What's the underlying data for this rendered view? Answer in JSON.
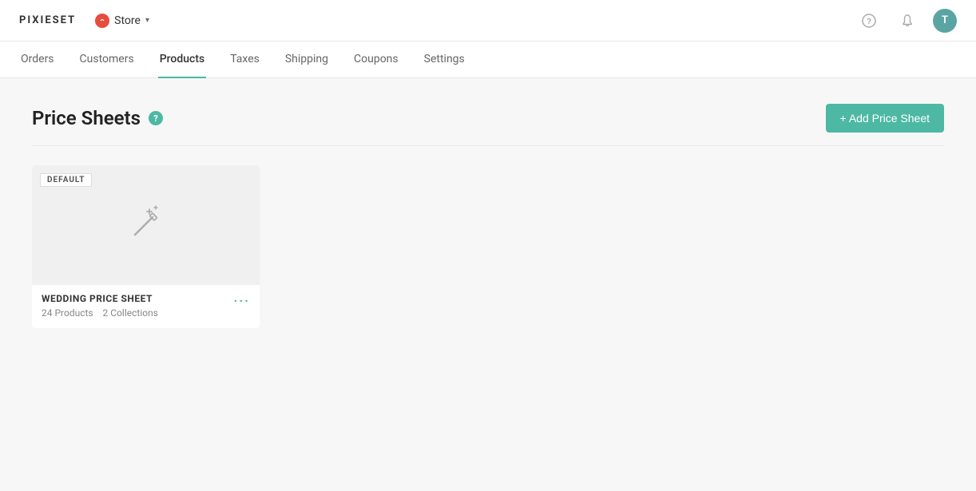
{
  "topNav": {
    "logo": "PIXIESET",
    "storeSwitcher": {
      "label": "Store",
      "icon": "store-icon"
    },
    "helpIcon": "?",
    "bellIcon": "🔔",
    "avatar": "T"
  },
  "secondaryNav": {
    "items": [
      {
        "label": "Orders",
        "active": false
      },
      {
        "label": "Customers",
        "active": false
      },
      {
        "label": "Products",
        "active": true
      },
      {
        "label": "Taxes",
        "active": false
      },
      {
        "label": "Shipping",
        "active": false
      },
      {
        "label": "Coupons",
        "active": false
      },
      {
        "label": "Settings",
        "active": false
      }
    ]
  },
  "pageHeader": {
    "title": "Price Sheets",
    "helpTooltip": "?",
    "addButton": "+ Add Price Sheet"
  },
  "priceSheets": [
    {
      "name": "WEDDING PRICE SHEET",
      "isDefault": true,
      "defaultLabel": "DEFAULT",
      "products": "24 Products",
      "collections": "2 Collections",
      "moreLabel": "···"
    }
  ]
}
